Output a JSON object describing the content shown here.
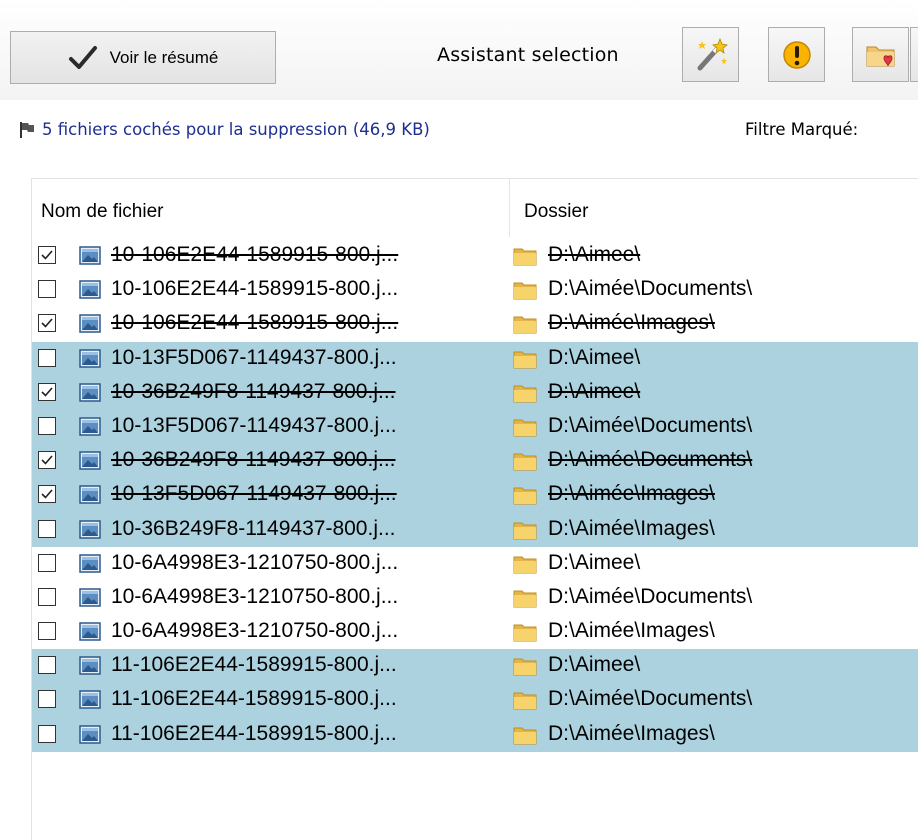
{
  "toolbar": {
    "summary_button_label": "Voir le résumé",
    "assistant_label": "Assistant selection",
    "icons": [
      "magic-wand-icon",
      "warning-icon",
      "folder-heart-icon"
    ]
  },
  "status": {
    "text": "5 fichiers cochés pour la suppression (46,9 KB)",
    "filter_label": "Filtre Marqué:"
  },
  "table": {
    "columns": [
      "Nom de fichier",
      "Dossier"
    ],
    "rows": [
      {
        "checked": true,
        "highlight": false,
        "name": "10-106E2E44-1589915-800.j...",
        "folder": "D:\\Aimee\\"
      },
      {
        "checked": false,
        "highlight": false,
        "name": "10-106E2E44-1589915-800.j...",
        "folder": "D:\\Aimée\\Documents\\"
      },
      {
        "checked": true,
        "highlight": false,
        "name": "10-106E2E44-1589915-800.j...",
        "folder": "D:\\Aimée\\Images\\"
      },
      {
        "checked": false,
        "highlight": true,
        "name": "10-13F5D067-1149437-800.j...",
        "folder": "D:\\Aimee\\"
      },
      {
        "checked": true,
        "highlight": true,
        "name": "10-36B249F8-1149437-800.j...",
        "folder": "D:\\Aimee\\"
      },
      {
        "checked": false,
        "highlight": true,
        "name": "10-13F5D067-1149437-800.j...",
        "folder": "D:\\Aimée\\Documents\\"
      },
      {
        "checked": true,
        "highlight": true,
        "name": "10-36B249F8-1149437-800.j...",
        "folder": "D:\\Aimée\\Documents\\"
      },
      {
        "checked": true,
        "highlight": true,
        "name": "10-13F5D067-1149437-800.j...",
        "folder": "D:\\Aimée\\Images\\"
      },
      {
        "checked": false,
        "highlight": true,
        "name": "10-36B249F8-1149437-800.j...",
        "folder": "D:\\Aimée\\Images\\"
      },
      {
        "checked": false,
        "highlight": false,
        "name": "10-6A4998E3-1210750-800.j...",
        "folder": "D:\\Aimee\\"
      },
      {
        "checked": false,
        "highlight": false,
        "name": "10-6A4998E3-1210750-800.j...",
        "folder": "D:\\Aimée\\Documents\\"
      },
      {
        "checked": false,
        "highlight": false,
        "name": "10-6A4998E3-1210750-800.j...",
        "folder": "D:\\Aimée\\Images\\"
      },
      {
        "checked": false,
        "highlight": true,
        "name": "11-106E2E44-1589915-800.j...",
        "folder": "D:\\Aimee\\"
      },
      {
        "checked": false,
        "highlight": true,
        "name": "11-106E2E44-1589915-800.j...",
        "folder": "D:\\Aimée\\Documents\\"
      },
      {
        "checked": false,
        "highlight": true,
        "name": "11-106E2E44-1589915-800.j...",
        "folder": "D:\\Aimée\\Images\\"
      }
    ]
  },
  "colors": {
    "highlight_row": "#abd2de",
    "status_text": "#1f2f8f",
    "folder_yellow": "#f6d36b"
  }
}
